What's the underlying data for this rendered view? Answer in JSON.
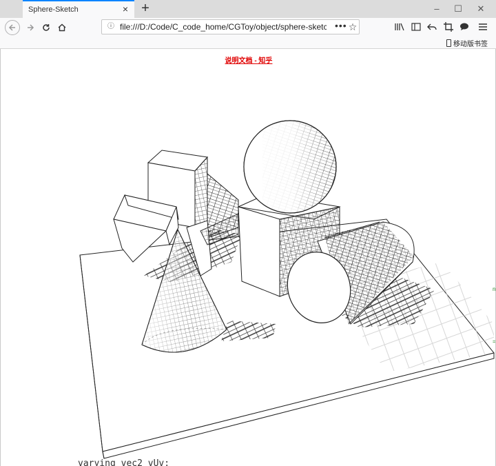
{
  "browser": {
    "tab_title": "Sphere-Sketch",
    "tab_close_icon": "close-icon",
    "new_tab_label": "+",
    "url": "file:///D:/Code/C_code_home/CGToy/object/sphere-sketch/",
    "url_more_label": "•••",
    "mobile_bookmarks_label": "移动版书签"
  },
  "page": {
    "doc_link_label": "说明文档  -  知乎",
    "code_peek": "varying vec2 vUv;"
  },
  "scene": {
    "objects": [
      "sphere",
      "cube",
      "cross-blocks",
      "cone",
      "cylinder",
      "ground-plane"
    ]
  },
  "colors": {
    "tab_accent": "#0a84ff",
    "link_red": "#e00000",
    "chrome_bg": "#f9f9fa"
  }
}
